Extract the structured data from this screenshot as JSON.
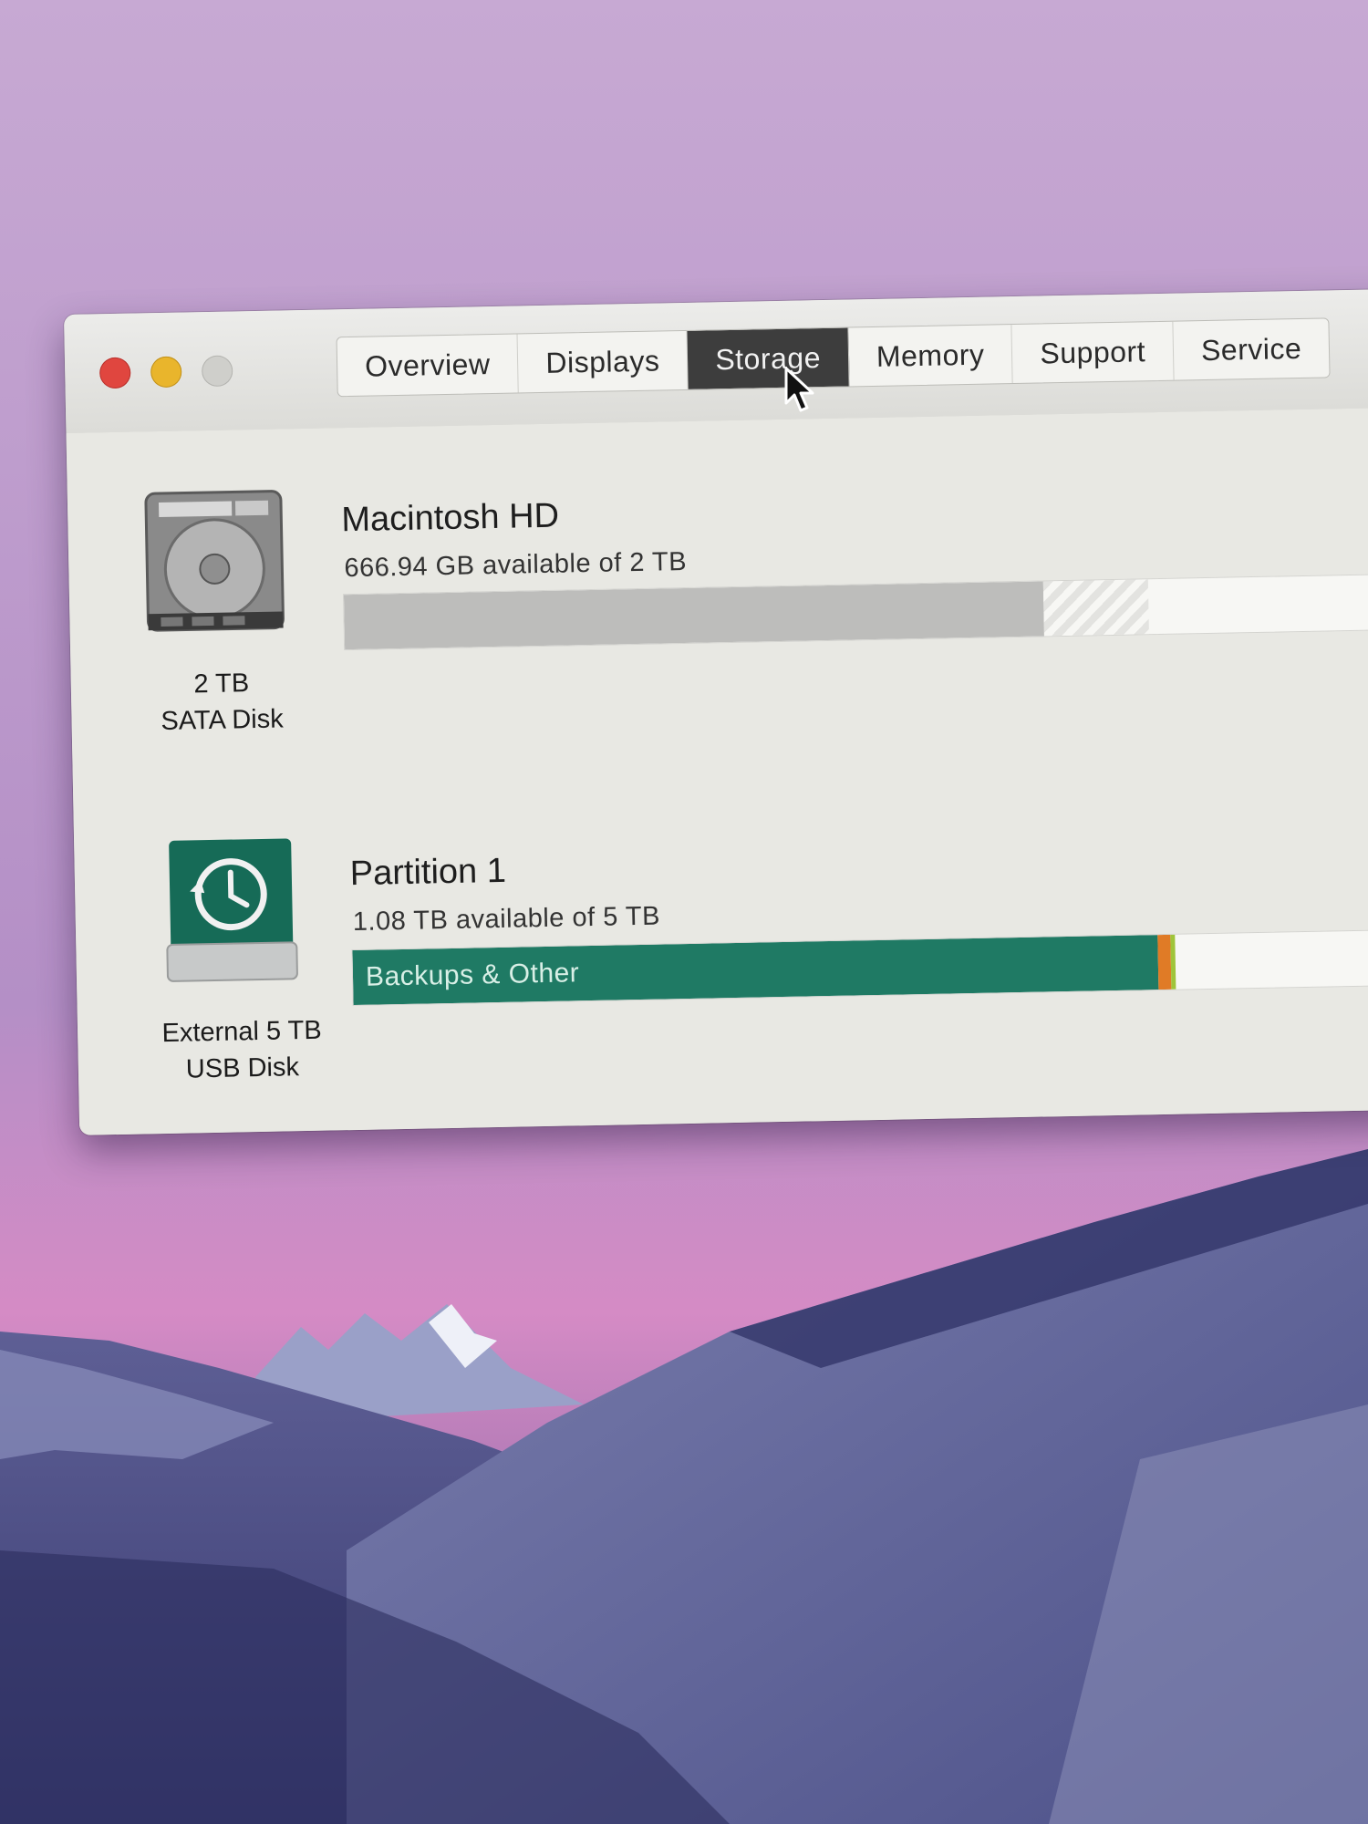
{
  "window": {
    "traffic_lights": [
      "close",
      "minimize",
      "zoom"
    ],
    "tabs": [
      {
        "label": "Overview",
        "active": false
      },
      {
        "label": "Displays",
        "active": false
      },
      {
        "label": "Storage",
        "active": true
      },
      {
        "label": "Memory",
        "active": false
      },
      {
        "label": "Support",
        "active": false
      },
      {
        "label": "Service",
        "active": false
      }
    ]
  },
  "storage": {
    "internal": {
      "icon": "hard-drive-icon",
      "capacity": "2 TB",
      "type": "SATA Disk",
      "volume_name": "Macintosh HD",
      "available_text": "666.94 GB available of 2 TB",
      "used_fraction": 0.667,
      "used_color": "#bdbdbb"
    },
    "external": {
      "icon": "time-machine-drive-icon",
      "capacity": "External 5 TB",
      "type": "USB Disk",
      "volume_name": "Partition 1",
      "available_text": "1.08 TB available of 5 TB",
      "segments": [
        {
          "label": "Backups & Other",
          "fraction": 0.768,
          "color": "#1f7a64"
        },
        {
          "label": "",
          "fraction": 0.012,
          "color": "#e07b26"
        },
        {
          "label": "",
          "fraction": 0.004,
          "color": "#9fc43a"
        }
      ]
    }
  },
  "colors": {
    "wallpaper_sky": "#b79ac4",
    "window_bg": "#e6e6e0",
    "active_tab": "#3d3d3d"
  }
}
